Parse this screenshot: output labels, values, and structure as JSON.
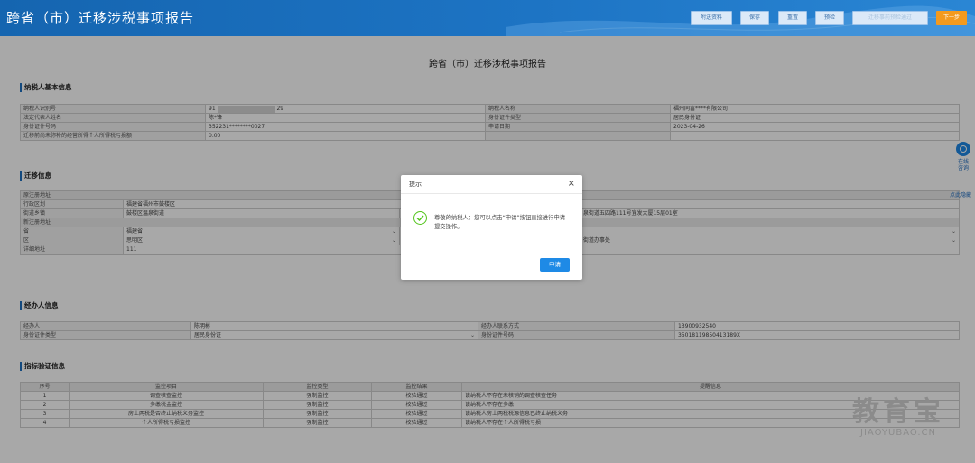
{
  "header": {
    "title": "跨省（市）迁移涉税事项报告",
    "buttons": [
      "附送资料",
      "保存",
      "重置",
      "预检",
      "迁移事前预检通过",
      "下一步"
    ]
  },
  "page": {
    "doc_title": "跨省（市）迁移涉税事项报告"
  },
  "basic_info": {
    "section_title": "纳税人基本信息",
    "rows": [
      {
        "l1": "纳税人识别号",
        "v1_prefix": "91",
        "v1_suffix": "29",
        "l2": "纳税人名称",
        "v2": "福州同富****有限公司"
      },
      {
        "l1": "法定代表人姓名",
        "v1": "陈*锋",
        "l2": "身份证件类型",
        "v2": "居民身份证"
      },
      {
        "l1": "身份证件号码",
        "v1": "352231********0027",
        "l2": "申请日期",
        "v2": "2023-04-26"
      },
      {
        "l1": "迁移前尚未弥补的经营所得个人所得税亏损额",
        "v1": "0.00"
      }
    ]
  },
  "migration": {
    "section_title": "迁移信息",
    "orig_addr_label": "原注册地址",
    "region_label": "行政区划",
    "region_value": "福建省福州市鼓楼区",
    "street_label": "街道乡镇",
    "street_value": "鼓楼区温泉街道",
    "addr_tail": "泉街道五四路111号宜发大厦15层01室",
    "new_addr_label": "新注册地址",
    "province_label": "省",
    "province_value": "福建省",
    "district_label": "区",
    "district_value": "思明区",
    "district_right": "街道办事处",
    "detail_label": "详细地址",
    "detail_value": "111"
  },
  "agent": {
    "section_title": "经办人信息",
    "name_label": "经办人",
    "name_value": "陈明彬",
    "phone_label": "经办人联系方式",
    "phone_value": "13900932540",
    "idtype_label": "身份证件类型",
    "idtype_value": "居民身份证",
    "idno_label": "身份证件号码",
    "idno_value": "35018119850413189X"
  },
  "indicators": {
    "section_title": "指标验证信息",
    "headers": [
      "序号",
      "监控项目",
      "监控类型",
      "监控结果",
      "提醒信息"
    ],
    "rows": [
      [
        "1",
        "调查核查监控",
        "强制监控",
        "校验通过",
        "该纳税人不存在未核销的调查核查任务"
      ],
      [
        "2",
        "多缴税金监控",
        "强制监控",
        "校验通过",
        "该纳税人不存在多缴"
      ],
      [
        "3",
        "房土两税是否终止纳税义务监控",
        "强制监控",
        "校验通过",
        "该纳税人房土两税税源信息已终止纳税义务"
      ],
      [
        "4",
        "个人所得税亏损监控",
        "强制监控",
        "校验通过",
        "该纳税人不存在个人所得税亏损"
      ]
    ]
  },
  "sidebar": {
    "consult_line1": "在线",
    "consult_line2": "咨询",
    "collapse": "点此隐藏"
  },
  "modal": {
    "title": "提示",
    "close": "×",
    "message": "尊敬的纳税人：您可以点击“申请”按钮直接进行申请提交操作。",
    "button": "申请"
  },
  "watermark": {
    "main": "教育宝",
    "sub": "JIAOYUBAO.CN"
  },
  "colors": {
    "header_bg": "#1d74c4",
    "primary": "#1e8ae6",
    "success": "#52c41a",
    "next_button": "#f39a1e"
  }
}
